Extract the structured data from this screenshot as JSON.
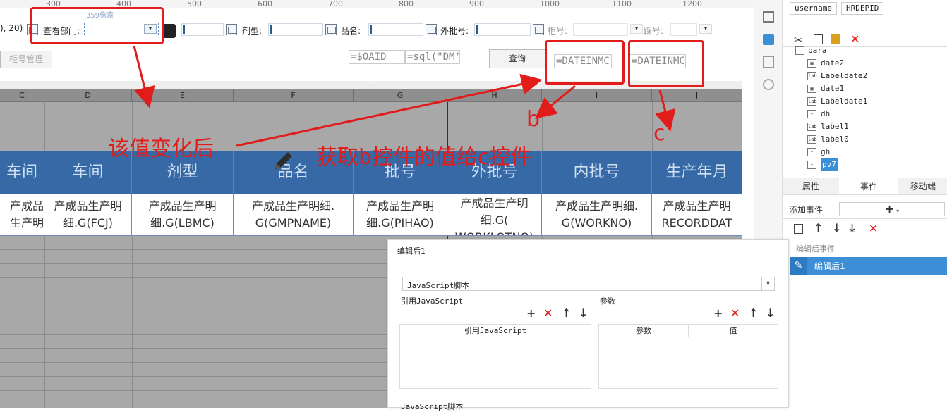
{
  "ruler": {
    "marks": [
      "300",
      "400",
      "500",
      "600",
      "700",
      "800",
      "900",
      "1000",
      "1100",
      "1200"
    ]
  },
  "size_tip": "359像素",
  "params": {
    "partial_left": "), 20)",
    "dept_label": "查看部门:",
    "dosage_label": "剂型:",
    "name_label": "品名:",
    "ext_batch_label": "外批号:",
    "cabinet_label": "柜号:",
    "pedal_label": "踩号:",
    "cabinet_mgmt_button": "柜号管理",
    "formula_oaid": "=$OAID",
    "formula_sql": "=sql(\"DM'",
    "query_button": "查询",
    "formula_b": "=DATEINMC",
    "formula_c": "=DATEINMC"
  },
  "columns": [
    "C",
    "D",
    "E",
    "F",
    "G",
    "H",
    "I",
    "J"
  ],
  "table": {
    "headers": [
      "车间",
      "车间",
      "剂型",
      "品名",
      "批号",
      "外批号",
      "内批号",
      "生产年月"
    ],
    "cells": [
      "产成品生产明\n(FCJ)",
      "产成品生产明\n细.G(FCJ)",
      "产成品生产明\n细.G(LBMC)",
      "产成品生产明细.\nG(GMPNAME)",
      "产成品生产明\n细.G(PIHAO)",
      "产成品生产明\n细.G(\nWORKLOTNO)",
      "产成品生产明细.\nG(WORKNO)",
      "产成品生产明\nRECORDDAT"
    ]
  },
  "annotations": {
    "after_change": "该值变化后",
    "get_value": "获取b控件的值给c控件",
    "b": "b",
    "c": "c"
  },
  "right_panel": {
    "tags": [
      "username",
      "HRDEPID"
    ],
    "tree": [
      {
        "name": "para",
        "type": "folder"
      },
      {
        "name": "date2",
        "type": "date"
      },
      {
        "name": "Labeldate2",
        "type": "label"
      },
      {
        "name": "date1",
        "type": "date"
      },
      {
        "name": "Labeldate1",
        "type": "label"
      },
      {
        "name": "dh",
        "type": "combo"
      },
      {
        "name": "label1",
        "type": "label"
      },
      {
        "name": "label0",
        "type": "label"
      },
      {
        "name": "gh",
        "type": "combo"
      },
      {
        "name": "pv7",
        "type": "combo"
      }
    ],
    "tabs": [
      "属性",
      "事件",
      "移动端"
    ],
    "add_event_label": "添加事件",
    "add_symbol": "+",
    "event_section": "编辑后事件",
    "event_item": "编辑后1"
  },
  "dialog": {
    "title": "编辑后1",
    "script_type": "JavaScript脚本",
    "ref_js_label": "引用JavaScript",
    "params_label": "参数",
    "ref_table_header": "引用JavaScript",
    "param_col": "参数",
    "value_col": "值",
    "script_label": "JavaScript脚本"
  },
  "colors": {
    "annotation": "#e21b1b",
    "header_blue": "#3669a5",
    "selected_blue": "#3c8fd6",
    "sheet_gray": "#a8a8a8"
  }
}
